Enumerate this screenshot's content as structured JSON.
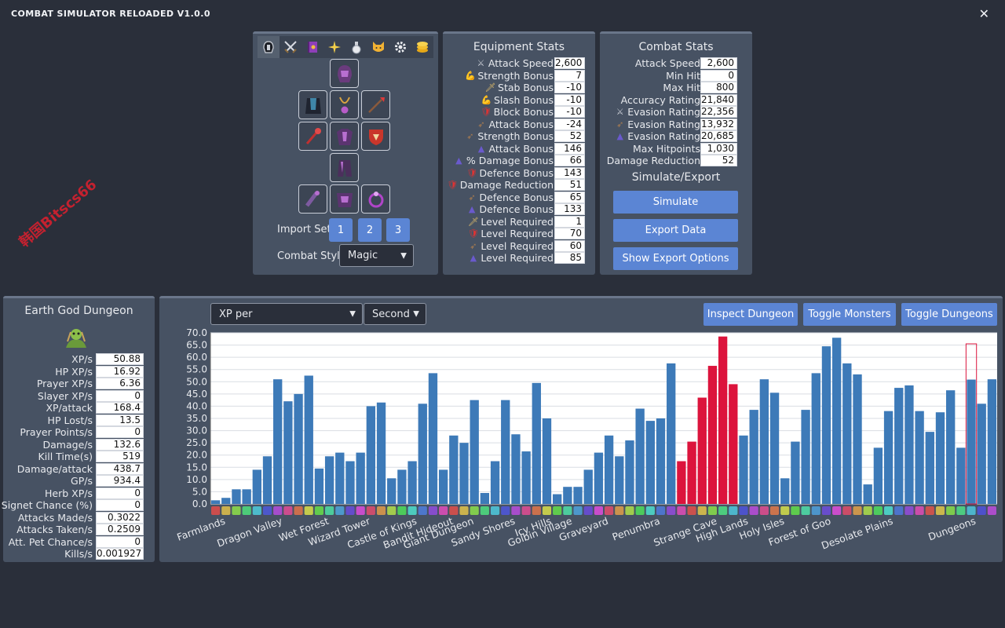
{
  "app": {
    "title": "COMBAT SIMULATOR RELOADED V1.0.0",
    "close_glyph": "✕"
  },
  "watermark": "韩国Bitscs66",
  "equipment": {
    "tabs": [
      "helmet-icon",
      "swords-icon",
      "spellbook-icon",
      "sparkle-icon",
      "potion-icon",
      "cat-icon",
      "gear-icon",
      "coins-icon"
    ],
    "import_label": "Import Set",
    "import_sets": [
      "1",
      "2",
      "3"
    ],
    "style_label": "Combat Style",
    "style_value": "Magic"
  },
  "equipment_stats": {
    "title": "Equipment Stats",
    "rows": [
      {
        "icon": "⚔",
        "color": "#c8ccd4",
        "label": "Attack Speed",
        "value": "2,600"
      },
      {
        "icon": "💪",
        "color": "#f0c79a",
        "label": "Strength Bonus",
        "value": "7"
      },
      {
        "icon": "🗡",
        "color": "#d9b76a",
        "label": "Stab Bonus",
        "value": "-10"
      },
      {
        "icon": "💪",
        "color": "#f0c79a",
        "label": "Slash Bonus",
        "value": "-10"
      },
      {
        "icon": "🛡",
        "color": "#d33",
        "label": "Block Bonus",
        "value": "-10"
      },
      {
        "icon": "➶",
        "color": "#a97c50",
        "label": "Attack Bonus",
        "value": "-24"
      },
      {
        "icon": "➶",
        "color": "#a97c50",
        "label": "Strength Bonus",
        "value": "52"
      },
      {
        "icon": "▲",
        "color": "#6a5acd",
        "label": "Attack Bonus",
        "value": "146"
      },
      {
        "icon": "▲",
        "color": "#6a5acd",
        "label": "% Damage Bonus",
        "value": "66"
      },
      {
        "icon": "🛡",
        "color": "#d33",
        "label": "Defence Bonus",
        "value": "143"
      },
      {
        "icon": "🛡",
        "color": "#d33",
        "label": "Damage Reduction",
        "value": "51"
      },
      {
        "icon": "➶",
        "color": "#a97c50",
        "label": "Defence Bonus",
        "value": "65"
      },
      {
        "icon": "▲",
        "color": "#6a5acd",
        "label": "Defence Bonus",
        "value": "133"
      },
      {
        "icon": "🗡",
        "color": "#d9b76a",
        "label": "Level Required",
        "value": "1"
      },
      {
        "icon": "🛡",
        "color": "#d33",
        "label": "Level Required",
        "value": "70"
      },
      {
        "icon": "➶",
        "color": "#a97c50",
        "label": "Level Required",
        "value": "60"
      },
      {
        "icon": "▲",
        "color": "#6a5acd",
        "label": "Level Required",
        "value": "85"
      }
    ]
  },
  "combat_stats": {
    "title": "Combat Stats",
    "rows": [
      {
        "icon": "",
        "label": "Attack Speed",
        "value": "2,600"
      },
      {
        "icon": "",
        "label": "Min Hit",
        "value": "0"
      },
      {
        "icon": "",
        "label": "Max Hit",
        "value": "800"
      },
      {
        "icon": "",
        "label": "Accuracy Rating",
        "value": "21,840"
      },
      {
        "icon": "⚔",
        "color": "#c8ccd4",
        "label": "Evasion Rating",
        "value": "22,356"
      },
      {
        "icon": "➶",
        "color": "#a97c50",
        "label": "Evasion Rating",
        "value": "13,932"
      },
      {
        "icon": "▲",
        "color": "#6a5acd",
        "label": "Evasion Rating",
        "value": "20,685"
      },
      {
        "icon": "",
        "label": "Max Hitpoints",
        "value": "1,030"
      },
      {
        "icon": "",
        "label": "Damage Reduction",
        "value": "52"
      }
    ],
    "sim_title": "Simulate/Export",
    "buttons": [
      "Simulate",
      "Export Data",
      "Show Export Options"
    ]
  },
  "dungeon": {
    "name": "Earth God Dungeon",
    "rows": [
      {
        "label": "XP/s",
        "value": "50.88"
      },
      {
        "label": "HP XP/s",
        "value": "16.92"
      },
      {
        "label": "Prayer XP/s",
        "value": "6.36"
      },
      {
        "label": "Slayer XP/s",
        "value": "0"
      },
      {
        "label": "XP/attack",
        "value": "168.4"
      },
      {
        "label": "HP Lost/s",
        "value": "13.5"
      },
      {
        "label": "Prayer Points/s",
        "value": "0"
      },
      {
        "label": "Damage/s",
        "value": "132.6"
      },
      {
        "label": "Kill Time(s)",
        "value": "519"
      },
      {
        "label": "Damage/attack",
        "value": "438.7"
      },
      {
        "label": "GP/s",
        "value": "934.4"
      },
      {
        "label": "Herb XP/s",
        "value": "0"
      },
      {
        "label": "Signet Chance (%)",
        "value": "0"
      },
      {
        "label": "Attacks Made/s",
        "value": "0.3022"
      },
      {
        "label": "Attacks Taken/s",
        "value": "0.2509"
      },
      {
        "label": "Att. Pet Chance/s",
        "value": "0"
      },
      {
        "label": "Kills/s",
        "value": "0.001927"
      }
    ]
  },
  "chart_controls": {
    "metric": "XP per",
    "unit": "Second",
    "buttons": [
      "Inspect Dungeon",
      "Toggle Monsters",
      "Toggle Dungeons"
    ]
  },
  "colors": {
    "bar": "#3d7ab8",
    "bar_highlight": "#dc143c",
    "selected_outline": "#dc143c",
    "button": "#5b85d4"
  },
  "chart_data": {
    "type": "bar",
    "ylim": [
      0,
      70
    ],
    "yticks": [
      "0.0",
      "5.0",
      "10.0",
      "15.0",
      "20.0",
      "25.0",
      "30.0",
      "35.0",
      "40.0",
      "45.0",
      "50.0",
      "55.0",
      "60.0",
      "65.0",
      "70.0"
    ],
    "values": [
      1.5,
      2.5,
      6,
      6,
      14,
      19.5,
      51,
      42,
      45,
      52.5,
      14.5,
      19.5,
      21,
      17.5,
      21,
      40,
      41.5,
      10.5,
      14,
      17.5,
      41,
      53.5,
      14,
      28,
      25,
      42.5,
      4.5,
      17.5,
      42.5,
      28.5,
      21.5,
      49.5,
      35,
      4,
      7,
      7,
      14,
      21,
      28,
      19.5,
      26,
      39,
      34,
      35,
      57.5,
      17.5,
      25.5,
      43.5,
      56.5,
      68.5,
      49,
      28,
      38.5,
      51,
      45.5,
      10.5,
      25.5,
      38.5,
      53.5,
      64.5,
      68,
      57.5,
      53,
      8,
      23,
      38,
      47.5,
      48.5,
      38,
      29.5,
      37.5,
      46.5,
      23,
      50.88,
      41,
      51
    ],
    "highlight_indices": [
      45,
      46,
      47,
      48,
      49,
      50
    ],
    "selected_index": 73,
    "group_labels": [
      {
        "label": "Farmlands",
        "at": 1.5
      },
      {
        "label": "Dragon Valley",
        "at": 7
      },
      {
        "label": "Wet Forest",
        "at": 11.5
      },
      {
        "label": "Wizard Tower",
        "at": 15.5
      },
      {
        "label": "Castle of Kings",
        "at": 20
      },
      {
        "label": "Bandit Hideout",
        "at": 23.5
      },
      {
        "label": "Giant Dungeon",
        "at": 25.5
      },
      {
        "label": "Sandy Shores",
        "at": 29.5
      },
      {
        "label": "Icy Hills",
        "at": 33
      },
      {
        "label": "Golbin Village",
        "at": 35
      },
      {
        "label": "Graveyard",
        "at": 38.5
      },
      {
        "label": "Penumbra",
        "at": 43.5
      },
      {
        "label": "Strange Cave",
        "at": 49
      },
      {
        "label": "High Lands",
        "at": 52
      },
      {
        "label": "Holy Isles",
        "at": 55.5
      },
      {
        "label": "Forest of Goo",
        "at": 60
      },
      {
        "label": "Desolate Plains",
        "at": 66
      },
      {
        "label": "Dungeons",
        "at": 74
      }
    ]
  }
}
